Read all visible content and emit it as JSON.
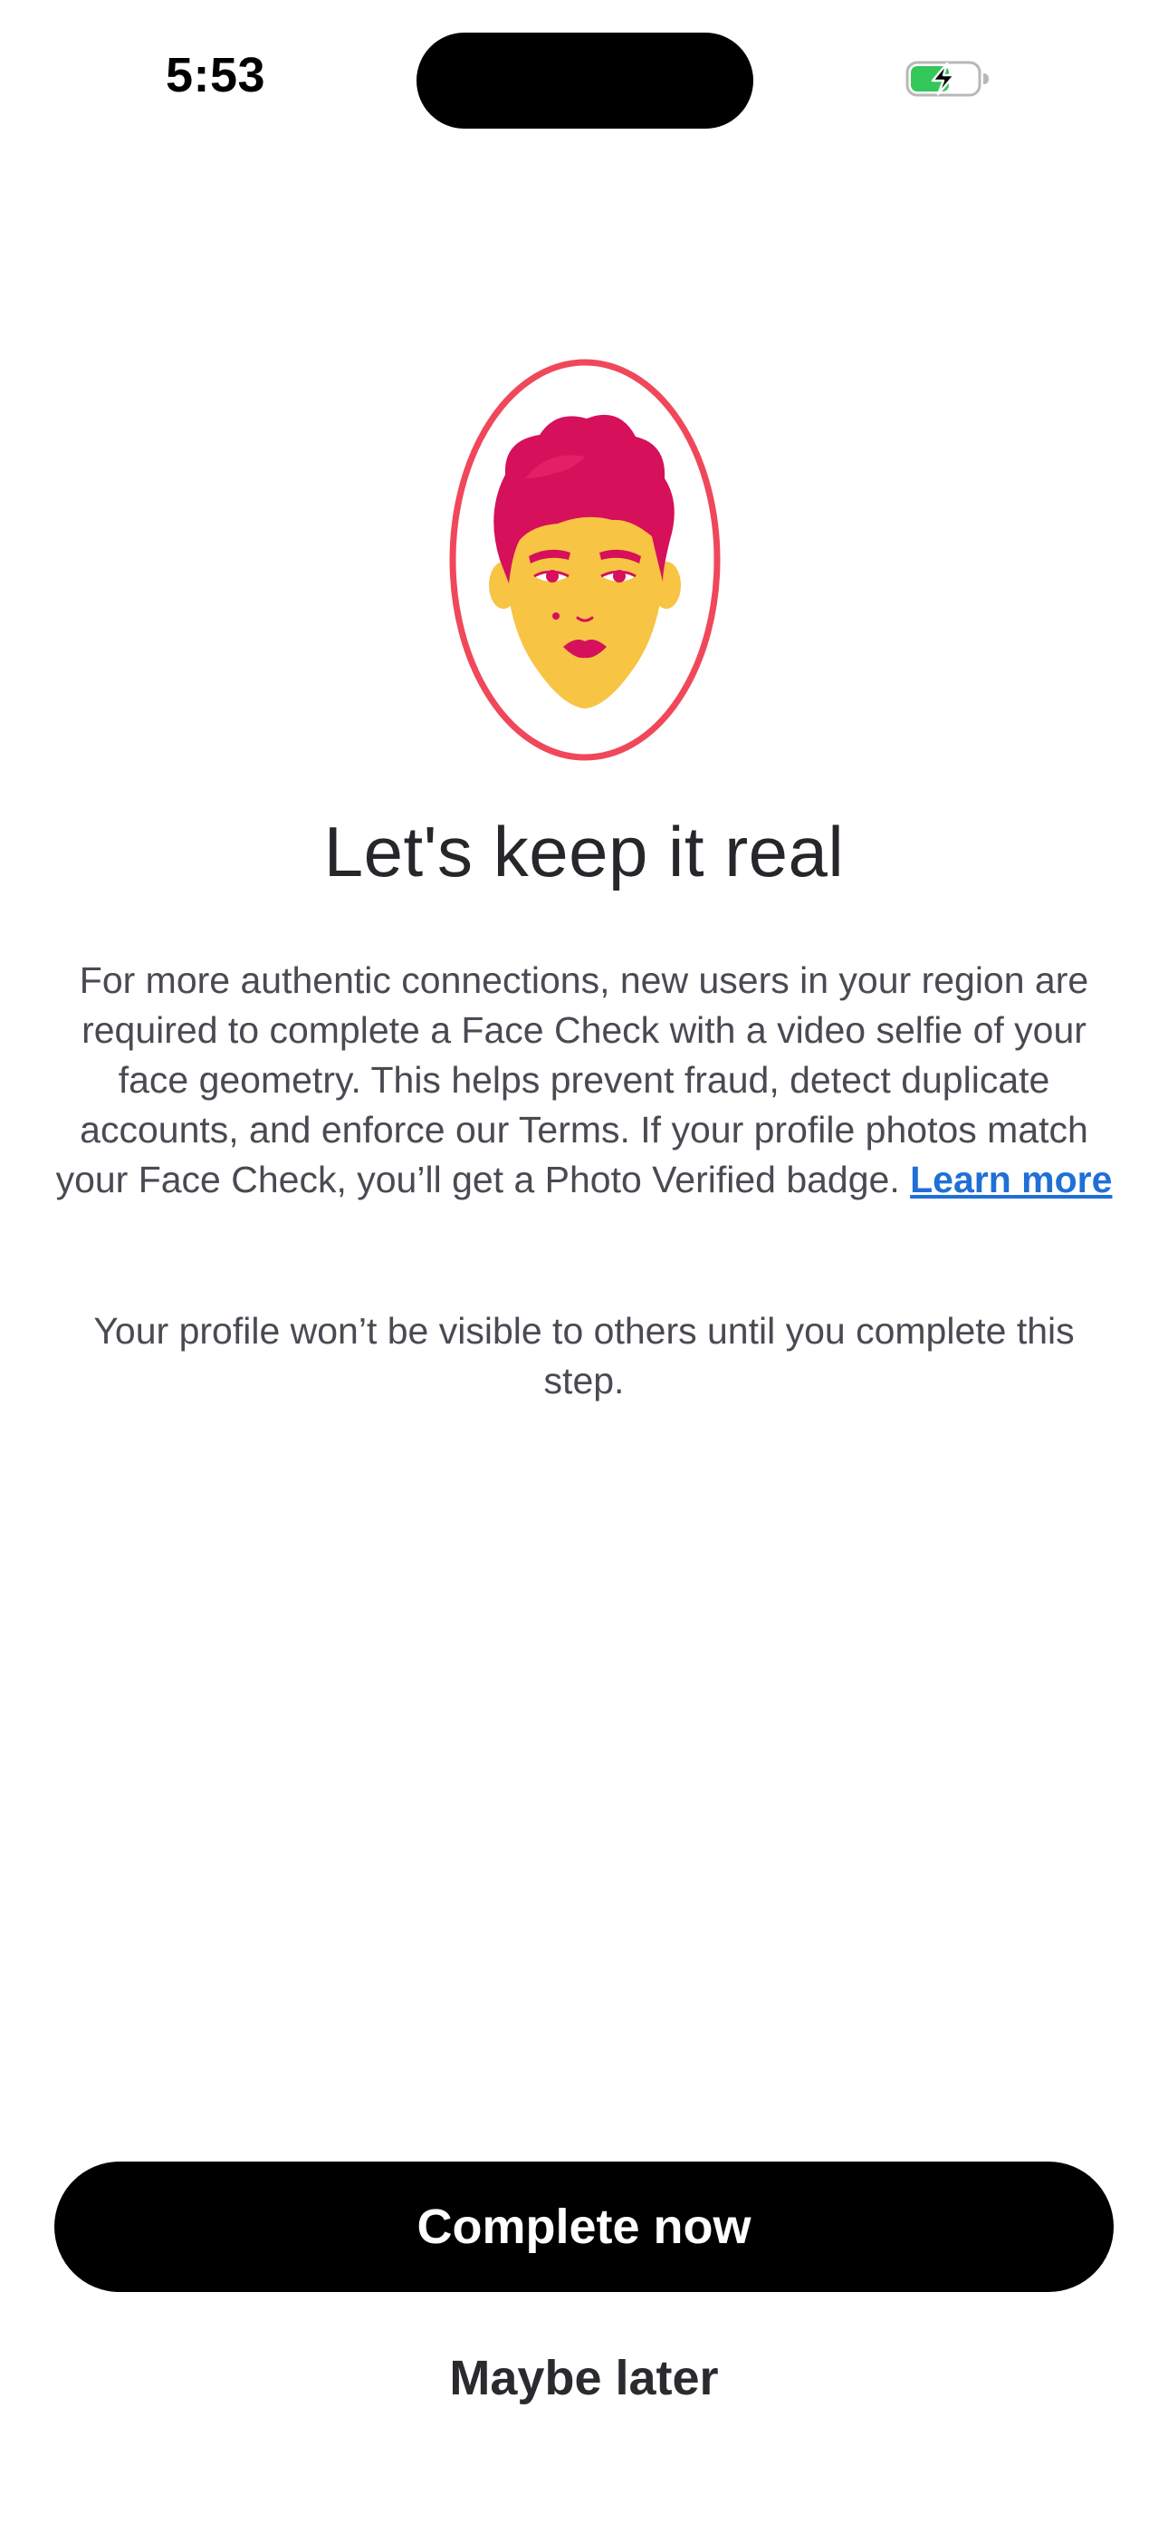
{
  "status_bar": {
    "time": "5:53",
    "battery_icon": "battery-charging-icon",
    "battery_color": "#34c759"
  },
  "hero": {
    "icon": "face-check-illustration",
    "ring_color": "#f0485a",
    "hair_color": "#d6105b",
    "face_color": "#f7c443"
  },
  "main": {
    "title": "Let's keep it real",
    "body": "For more authentic connections, new users in your region are required to complete a Face Check with a video selfie of your face geometry. This helps prevent fraud, detect duplicate accounts, and enforce our Terms. If your profile photos match your Face Check, you’ll get a Photo Verified badge.",
    "learn_more": "Learn more",
    "visibility_note": "Your profile won’t be visible to others until you complete this step."
  },
  "actions": {
    "primary_label": "Complete now",
    "secondary_label": "Maybe later"
  },
  "colors": {
    "link": "#1f6fd6",
    "primary_button_bg": "#000000",
    "primary_button_text": "#ffffff"
  }
}
